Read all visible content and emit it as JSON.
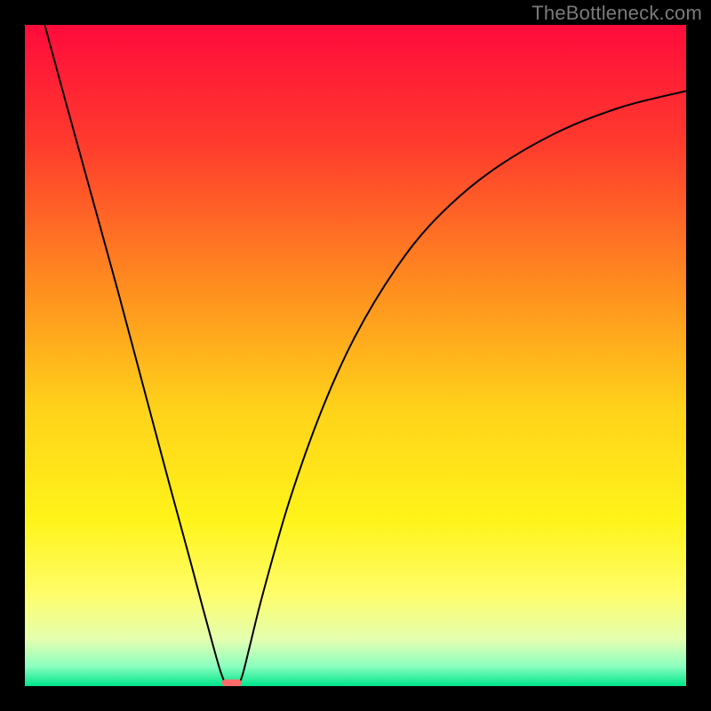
{
  "watermark": "TheBottleneck.com",
  "chart_data": {
    "type": "line",
    "title": "",
    "xlabel": "",
    "ylabel": "",
    "xlim": [
      0,
      100
    ],
    "ylim": [
      0,
      100
    ],
    "background_gradient": {
      "stops": [
        {
          "offset": 0.0,
          "color": "#ff0b3c"
        },
        {
          "offset": 0.18,
          "color": "#ff3b2d"
        },
        {
          "offset": 0.4,
          "color": "#ff8f1f"
        },
        {
          "offset": 0.58,
          "color": "#ffd21a"
        },
        {
          "offset": 0.75,
          "color": "#fff41a"
        },
        {
          "offset": 0.86,
          "color": "#fffd6a"
        },
        {
          "offset": 0.93,
          "color": "#e4ffb0"
        },
        {
          "offset": 0.97,
          "color": "#8bffc0"
        },
        {
          "offset": 1.0,
          "color": "#00e58a"
        }
      ]
    },
    "series": [
      {
        "name": "bottleneck-curve",
        "color": "#000000",
        "points": [
          {
            "x": 3.0,
            "y": 100.0
          },
          {
            "x": 6.0,
            "y": 89.0
          },
          {
            "x": 10.0,
            "y": 74.5
          },
          {
            "x": 14.0,
            "y": 60.0
          },
          {
            "x": 18.0,
            "y": 45.0
          },
          {
            "x": 22.0,
            "y": 30.0
          },
          {
            "x": 25.0,
            "y": 19.0
          },
          {
            "x": 27.0,
            "y": 11.5
          },
          {
            "x": 28.5,
            "y": 6.0
          },
          {
            "x": 29.5,
            "y": 2.5
          },
          {
            "x": 30.3,
            "y": 0.4
          },
          {
            "x": 30.8,
            "y": 0.0
          },
          {
            "x": 31.8,
            "y": 0.0
          },
          {
            "x": 32.4,
            "y": 0.4
          },
          {
            "x": 33.0,
            "y": 2.0
          },
          {
            "x": 34.0,
            "y": 6.0
          },
          {
            "x": 36.0,
            "y": 14.0
          },
          {
            "x": 40.0,
            "y": 28.0
          },
          {
            "x": 45.0,
            "y": 42.0
          },
          {
            "x": 50.0,
            "y": 53.0
          },
          {
            "x": 56.0,
            "y": 63.0
          },
          {
            "x": 62.0,
            "y": 70.5
          },
          {
            "x": 70.0,
            "y": 77.5
          },
          {
            "x": 80.0,
            "y": 83.5
          },
          {
            "x": 90.0,
            "y": 87.5
          },
          {
            "x": 100.0,
            "y": 90.0
          }
        ]
      }
    ],
    "marker": {
      "name": "min-point-marker",
      "shape": "rounded-bar",
      "color": "#ff6b6b",
      "x_center": 31.3,
      "width": 3.0,
      "y": 0.0,
      "height": 1.0
    }
  }
}
